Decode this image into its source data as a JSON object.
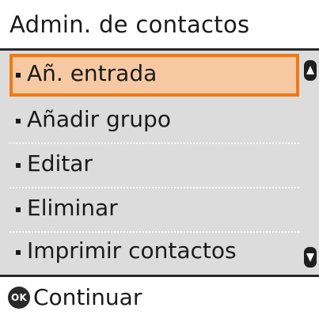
{
  "header": {
    "title": "Admin. de contactos"
  },
  "menu": {
    "items": [
      {
        "label": "Añ. entrada",
        "selected": true
      },
      {
        "label": "Añadir grupo",
        "selected": false
      },
      {
        "label": "Editar",
        "selected": false
      },
      {
        "label": "Eliminar",
        "selected": false
      },
      {
        "label": "Imprimir contactos",
        "selected": false
      }
    ],
    "scroll_up_icon": "arrow-up-icon",
    "scroll_down_icon": "arrow-down-icon"
  },
  "footer": {
    "ok_badge": "OK",
    "action_label": "Continuar"
  },
  "colors": {
    "selection_fill": "#f7c9a3",
    "selection_border": "#f07a12",
    "list_background": "#dcdcdc"
  }
}
